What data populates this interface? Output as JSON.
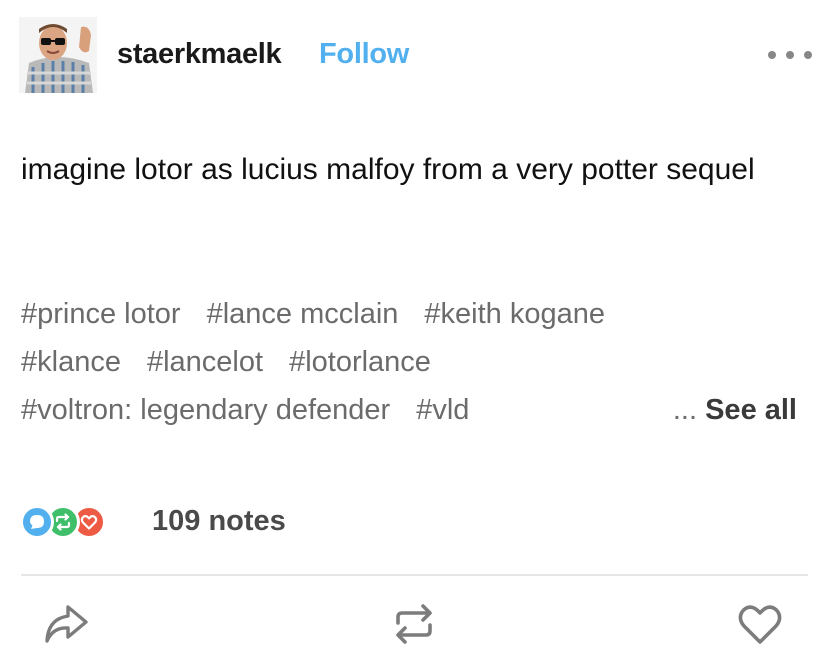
{
  "post": {
    "username": "staerkmaelk",
    "follow_label": "Follow",
    "body": "imagine lotor as lucius malfoy from a very potter sequel"
  },
  "tags": {
    "line1": [
      "#prince lotor",
      "#lance mcclain",
      "#keith kogane"
    ],
    "line2": [
      "#klance",
      "#lancelot",
      "#lotorlance"
    ],
    "line3": [
      "#voltron: legendary defender",
      "#vld"
    ],
    "see_all_prefix": "...",
    "see_all_label": "See all"
  },
  "notes": {
    "count_label": "109 notes",
    "icons": [
      "reply-icon",
      "reblog-icon",
      "like-icon"
    ]
  },
  "actions": {
    "icons": [
      "share-icon",
      "reblog-icon",
      "heart-icon"
    ]
  },
  "colors": {
    "follow": "#52b0ef",
    "reply": "#52b0ef",
    "reblog": "#3fbf6a",
    "like": "#ee5b45"
  }
}
